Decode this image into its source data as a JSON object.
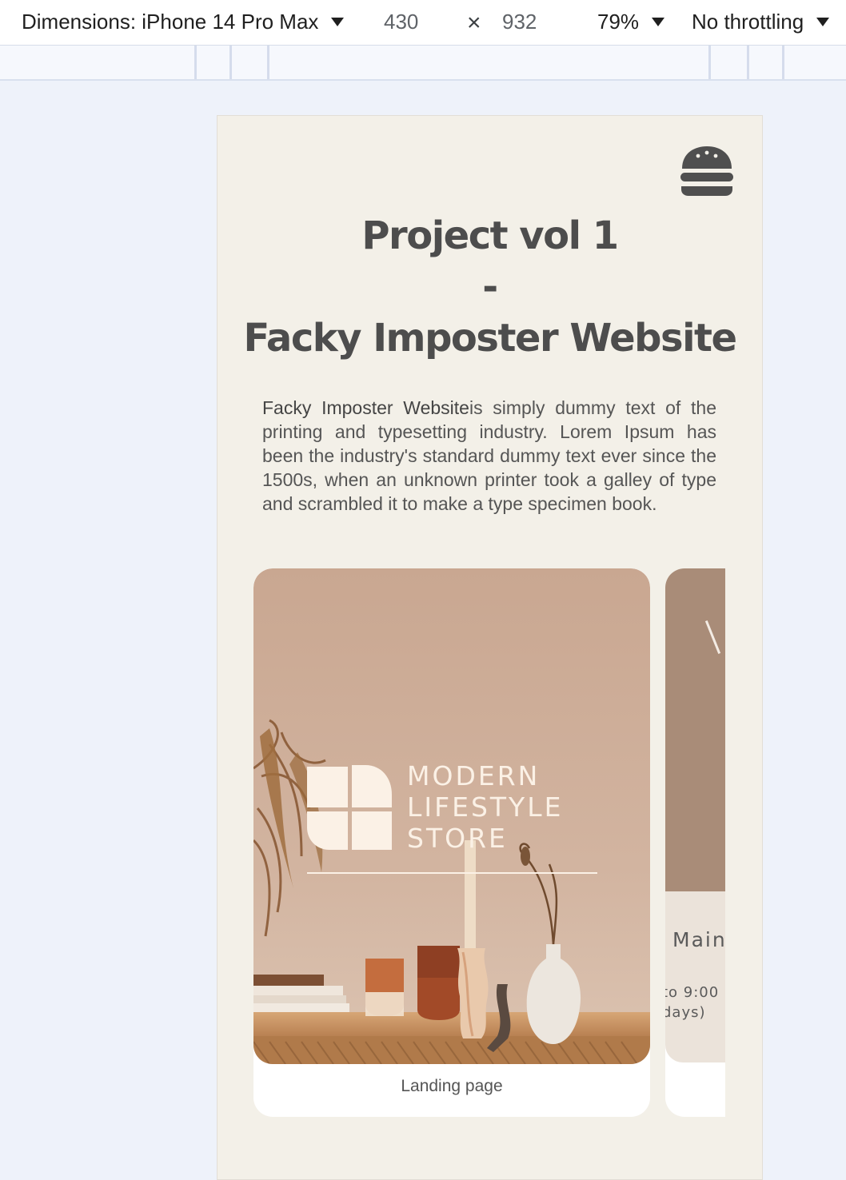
{
  "devtools": {
    "dimensions_label": "Dimensions: iPhone 14 Pro Max",
    "width": "430",
    "times": "×",
    "height": "932",
    "zoom": "79%",
    "throttling": "No throttling"
  },
  "page": {
    "menu_icon": "burger-icon",
    "title_line1": "Project vol 1",
    "title_dash": "-",
    "title_line2": "Facky Imposter Website",
    "desc_strong": "Facky Imposter Website",
    "desc_rest": "is simply dummy text of the printing and typesetting industry. Lorem Ipsum has been the industry's standard dummy text ever since the 1500s, when an unknown printer took a galley of type and scrambled it to make a type specimen book."
  },
  "cards": [
    {
      "logo_line1": "MODERN",
      "logo_line2": "LIFESTYLE",
      "logo_line3": "STORE",
      "caption": "Landing page"
    },
    {
      "main_text": "Main",
      "hours_line1": "to 9:00",
      "hours_line2": "days)"
    }
  ],
  "colors": {
    "page_bg": "#f3f0e8",
    "title": "#4d4d4d",
    "card_photo": "#cfae96"
  }
}
